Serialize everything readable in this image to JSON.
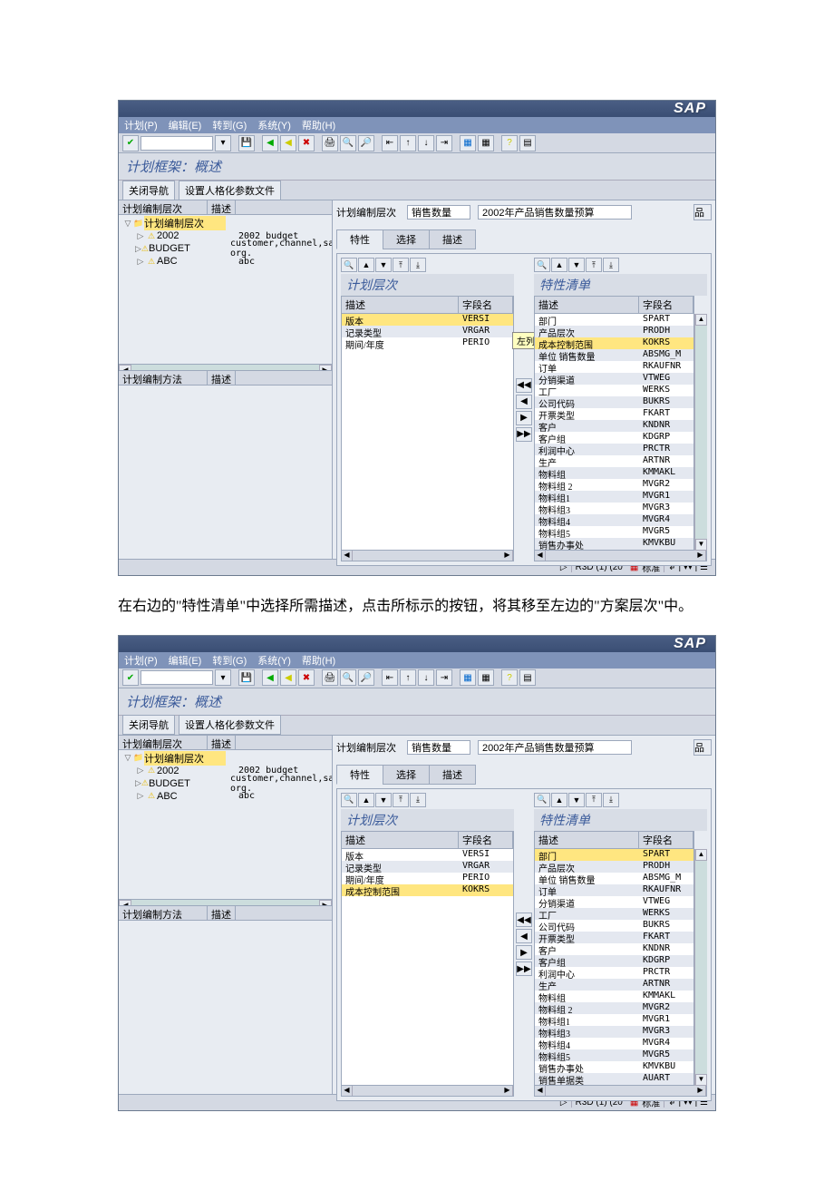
{
  "doc_text": "在右边的\"特性清单\"中选择所需描述，点击所标示的按钮，将其移至左边的\"方案层次\"中。",
  "shared": {
    "menubar": [
      "计划(P)",
      "编辑(E)",
      "转到(G)",
      "系统(Y)",
      "帮助(H)"
    ],
    "page_title": "计划框架：概述",
    "toolbar2": [
      "关闭导航",
      "设置人格化参数文件"
    ],
    "tree_cols": [
      "计划编制层次",
      "描述"
    ],
    "tree_root": "计划编制层次",
    "tree_items": [
      {
        "lbl": "2002",
        "desc": "2002 budget"
      },
      {
        "lbl": "BUDGET",
        "desc": "customer,channel,sales org."
      },
      {
        "lbl": "ABC",
        "desc": "abc"
      }
    ],
    "method_cols": [
      "计划编制方法",
      "描述"
    ],
    "rt_label": "计划编制层次",
    "rt_field1": "销售数量",
    "rt_field2": "2002年产品销售数量预算",
    "tabs": [
      "特性",
      "选择",
      "描述"
    ],
    "left_list_title": "计划层次",
    "right_list_title": "特性清单",
    "list_cols": [
      "描述",
      "字段名"
    ],
    "statusbar": {
      "seg1": "R3D (1) (20",
      "seg2": "标准"
    },
    "sap": "SAP"
  },
  "s1": {
    "left_rows": [
      {
        "d": "版本",
        "f": "VERSI",
        "sel": true
      },
      {
        "d": "记录类型",
        "f": "VRGAR"
      },
      {
        "d": "期间/年度",
        "f": "PERIO"
      }
    ],
    "right_rows": [
      {
        "d": "部门",
        "f": "SPART"
      },
      {
        "d": "产品层次",
        "f": "PRODH"
      },
      {
        "d": "成本控制范围",
        "f": "KOKRS",
        "sel": true
      },
      {
        "d": "单位 销售数量",
        "f": "ABSMG_M"
      },
      {
        "d": "订单",
        "f": "RKAUFNR"
      },
      {
        "d": "分销渠道",
        "f": "VTWEG"
      },
      {
        "d": "工厂",
        "f": "WERKS"
      },
      {
        "d": "公司代码",
        "f": "BUKRS"
      },
      {
        "d": "开票类型",
        "f": "FKART"
      },
      {
        "d": "客户",
        "f": "KNDNR"
      },
      {
        "d": "客户组",
        "f": "KDGRP"
      },
      {
        "d": "利润中心",
        "f": "PRCTR"
      },
      {
        "d": "生产",
        "f": "ARTNR"
      },
      {
        "d": "物料组",
        "f": "KMMAKL"
      },
      {
        "d": "物料组 2",
        "f": "MVGR2"
      },
      {
        "d": "物料组1",
        "f": "MVGR1"
      },
      {
        "d": "物料组3",
        "f": "MVGR3"
      },
      {
        "d": "物料组4",
        "f": "MVGR4"
      },
      {
        "d": "物料组5",
        "f": "MVGR5"
      },
      {
        "d": "销售办事处",
        "f": "KMVKBU"
      }
    ],
    "tooltip": "左列.前一个..."
  },
  "s2": {
    "left_rows": [
      {
        "d": "版本",
        "f": "VERSI"
      },
      {
        "d": "记录类型",
        "f": "VRGAR"
      },
      {
        "d": "期间/年度",
        "f": "PERIO"
      },
      {
        "d": "成本控制范围",
        "f": "KOKRS",
        "sel": true
      }
    ],
    "right_rows": [
      {
        "d": "部门",
        "f": "SPART",
        "sel": true
      },
      {
        "d": "产品层次",
        "f": "PRODH"
      },
      {
        "d": "单位 销售数量",
        "f": "ABSMG_M"
      },
      {
        "d": "订单",
        "f": "RKAUFNR"
      },
      {
        "d": "分销渠道",
        "f": "VTWEG"
      },
      {
        "d": "工厂",
        "f": "WERKS"
      },
      {
        "d": "公司代码",
        "f": "BUKRS"
      },
      {
        "d": "开票类型",
        "f": "FKART"
      },
      {
        "d": "客户",
        "f": "KNDNR"
      },
      {
        "d": "客户组",
        "f": "KDGRP"
      },
      {
        "d": "利润中心",
        "f": "PRCTR"
      },
      {
        "d": "生产",
        "f": "ARTNR"
      },
      {
        "d": "物料组",
        "f": "KMMAKL"
      },
      {
        "d": "物料组 2",
        "f": "MVGR2"
      },
      {
        "d": "物料组1",
        "f": "MVGR1"
      },
      {
        "d": "物料组3",
        "f": "MVGR3"
      },
      {
        "d": "物料组4",
        "f": "MVGR4"
      },
      {
        "d": "物料组5",
        "f": "MVGR5"
      },
      {
        "d": "销售办事处",
        "f": "KMVKBU"
      },
      {
        "d": "销售单据类",
        "f": "AUART"
      }
    ]
  }
}
